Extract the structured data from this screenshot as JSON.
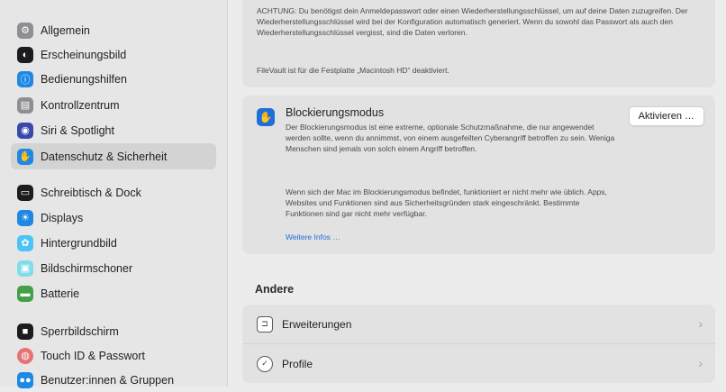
{
  "sidebar": {
    "items": [
      {
        "label": "Allgemein",
        "icon": "gear-icon",
        "color": "#8e8e93",
        "glyph": "⚙"
      },
      {
        "label": "Erscheinungsbild",
        "icon": "appearance-icon",
        "color": "#1c1c1e",
        "glyph": "◐"
      },
      {
        "label": "Bedienungshilfen",
        "icon": "accessibility-icon",
        "color": "#1e88e5",
        "glyph": "ⓘ"
      },
      {
        "label": "Kontrollzentrum",
        "icon": "control-center-icon",
        "color": "#8e8e93",
        "glyph": "▤"
      },
      {
        "label": "Siri & Spotlight",
        "icon": "siri-icon",
        "color": "#3949ab",
        "glyph": "◉"
      },
      {
        "label": "Datenschutz & Sicherheit",
        "icon": "hand-icon",
        "color": "#1e88e5",
        "glyph": "✋"
      },
      {
        "label": "Schreibtisch & Dock",
        "icon": "dock-icon",
        "color": "#1c1c1e",
        "glyph": "▭"
      },
      {
        "label": "Displays",
        "icon": "display-icon",
        "color": "#1e88e5",
        "glyph": "☀"
      },
      {
        "label": "Hintergrundbild",
        "icon": "wallpaper-icon",
        "color": "#4fc3f7",
        "glyph": "✿"
      },
      {
        "label": "Bildschirmschoner",
        "icon": "screensaver-icon",
        "color": "#80deea",
        "glyph": "▣"
      },
      {
        "label": "Batterie",
        "icon": "battery-icon",
        "color": "#43a047",
        "glyph": "▬"
      },
      {
        "label": "Sperrbildschirm",
        "icon": "lock-icon",
        "color": "#1c1c1e",
        "glyph": "🔒"
      },
      {
        "label": "Touch ID & Passwort",
        "icon": "fingerprint-icon",
        "color": "#e57373",
        "glyph": "◍"
      },
      {
        "label": "Benutzer:innen & Gruppen",
        "icon": "users-icon",
        "color": "#1e88e5",
        "glyph": "👥"
      }
    ]
  },
  "filevault": {
    "warning": "ACHTUNG: Du benötigst dein Anmeldepasswort oder einen Wiederherstellungsschlüssel, um auf deine Daten zuzugreifen. Der Wiederherstellungsschlüssel wird bei der Konfiguration automatisch generiert. Wenn du sowohl das Passwort als auch den Wiederherstellungsschlüssel vergisst, sind die Daten verloren.",
    "status": "FileVault ist für die Festplatte „Macintosh HD“ deaktiviert."
  },
  "lockdown": {
    "title": "Blockierungsmodus",
    "button": "Aktivieren …",
    "desc1": "Der Blockierungsmodus ist eine extreme, optionale Schutzmaßnahme, die nur angewendet werden sollte, wenn du annimmst, von einem ausgefeilten Cyberangriff betroffen zu sein. Weniga Menschen sind jemals von solch einem Angriff betroffen.",
    "desc2": "Wenn sich der Mac im Blockierungsmodus befindet, funktioniert er nicht mehr wie üblich. Apps, Websites und Funktionen sind aus Sicherheitsgründen stark eingeschränkt. Bestimmte Funktionen sind gar nicht mehr verfügbar.",
    "link": "Weitere Infos …"
  },
  "other": {
    "heading": "Andere",
    "rows": [
      {
        "label": "Erweiterungen",
        "icon": "extensions-icon"
      },
      {
        "label": "Profile",
        "icon": "profiles-icon"
      }
    ],
    "chevron": "›"
  },
  "colors": {
    "accent": "#1e6fd9"
  }
}
